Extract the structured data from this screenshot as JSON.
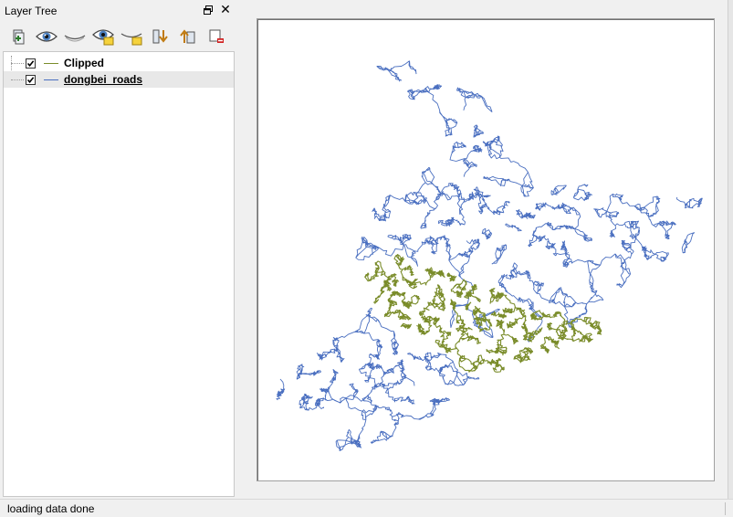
{
  "dock": {
    "title": "Layer Tree"
  },
  "toolbar": {
    "buttons": [
      {
        "icon": "add-layer-icon"
      },
      {
        "icon": "show-all-layers-icon"
      },
      {
        "icon": "hide-all-layers-icon"
      },
      {
        "icon": "show-selected-layers-icon"
      },
      {
        "icon": "hide-selected-layers-icon"
      },
      {
        "icon": "move-layer-down-icon"
      },
      {
        "icon": "move-layer-up-icon"
      },
      {
        "icon": "remove-layer-icon"
      }
    ]
  },
  "layers": [
    {
      "name": "Clipped",
      "checked": true,
      "color": "#7a8c2a",
      "selected": false
    },
    {
      "name": "dongbei_roads",
      "checked": true,
      "color": "#4a6fc0",
      "selected": true
    }
  ],
  "status": {
    "message": "loading data done"
  },
  "colors": {
    "clipped": "#7a8c2a",
    "roads": "#4a6fc0"
  }
}
